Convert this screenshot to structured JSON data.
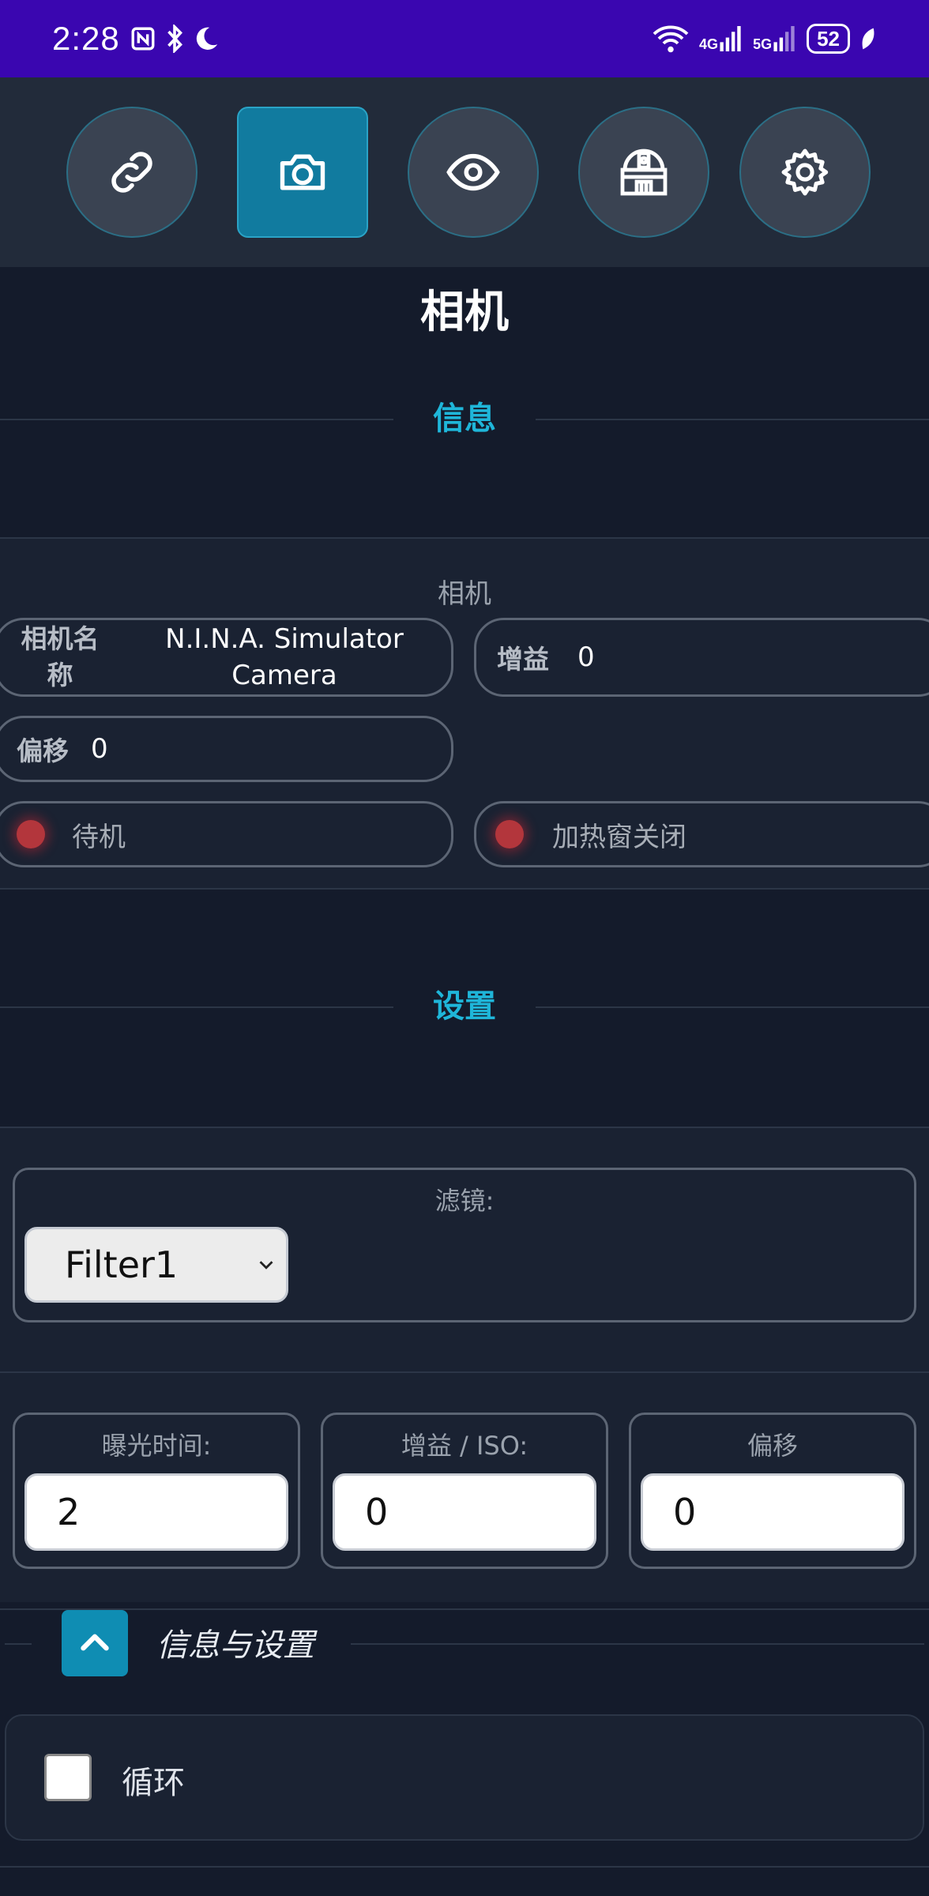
{
  "status_bar": {
    "time": "2:28",
    "network_4g": "4G",
    "network_5g": "5G",
    "battery": "52"
  },
  "toolbar": {
    "buttons": [
      {
        "icon": "link-icon"
      },
      {
        "icon": "camera-icon",
        "active": true
      },
      {
        "icon": "eye-icon"
      },
      {
        "icon": "observatory-icon"
      },
      {
        "icon": "gear-icon"
      }
    ]
  },
  "page": {
    "title": "相机"
  },
  "info_section": {
    "header": "信息",
    "camera_caption": "相机",
    "camera_name_label": "相机名称",
    "camera_name_value": "N.I.N.A. Simulator Camera",
    "gain_label": "增益",
    "gain_value": "0",
    "offset_label": "偏移",
    "offset_value": "0",
    "state_text": "待机",
    "heater_text": "加热窗关闭",
    "status_color": "#b3363c"
  },
  "settings_section": {
    "header": "设置",
    "filter_label": "滤镜:",
    "filter_selected": "Filter1",
    "exposure_label": "曝光时间:",
    "exposure_value": "2",
    "gain_iso_label": "增益 / ISO:",
    "gain_iso_value": "0",
    "offset_label": "偏移",
    "offset_value": "0"
  },
  "collapse": {
    "label": "信息与设置"
  },
  "loop": {
    "label": "循环",
    "checked": false
  },
  "colors": {
    "accent": "#1fb6d9",
    "active_button": "#117b9f",
    "background": "#141b2b",
    "status_bar": "#3a06b0"
  }
}
